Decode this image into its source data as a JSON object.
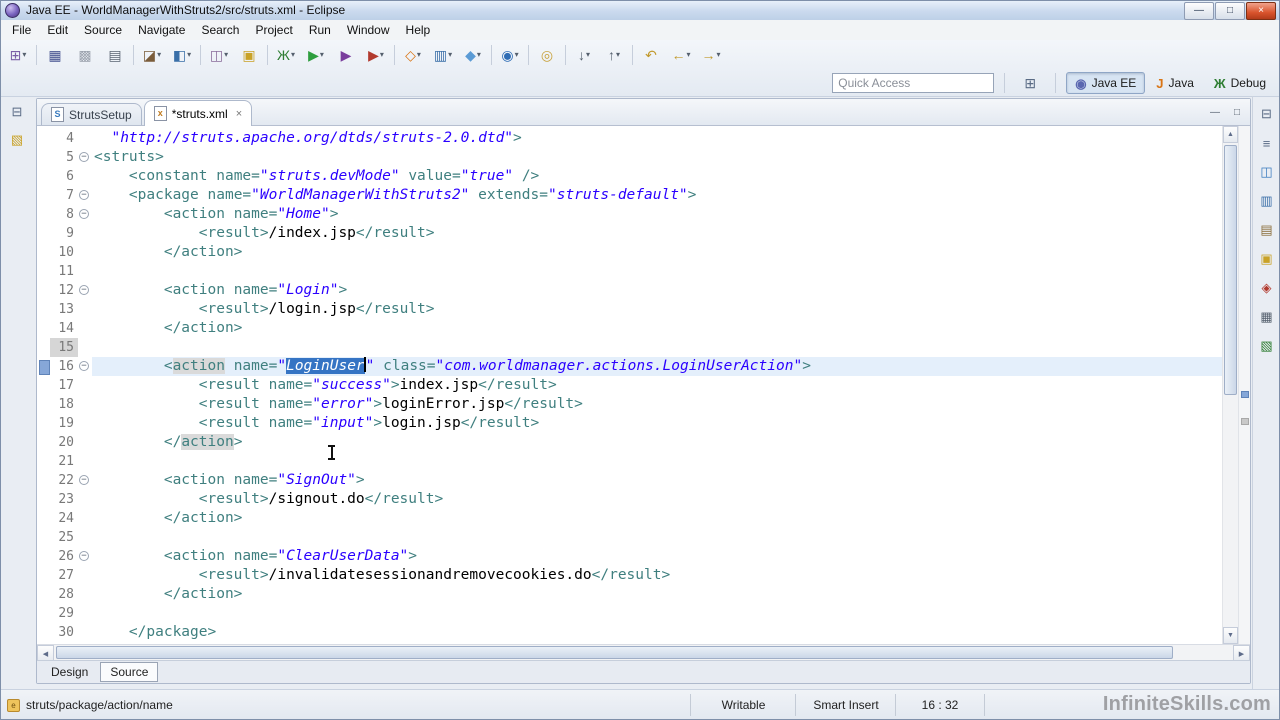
{
  "colors": {
    "xml_tag": "#3F7F7F",
    "xml_value": "#2A00FF",
    "selection_bg": "#3574C4",
    "selection_fg": "#FFFFFF",
    "current_line": "#E4EFFB",
    "occurrence": "#DADADA",
    "line_number": "#787878"
  },
  "window": {
    "title": "Java EE - WorldManagerWithStruts2/src/struts.xml - Eclipse",
    "buttons": [
      {
        "name": "minimize",
        "g": "—"
      },
      {
        "name": "maximize",
        "g": "□"
      },
      {
        "name": "close",
        "g": "×"
      }
    ]
  },
  "menus": [
    "File",
    "Edit",
    "Source",
    "Navigate",
    "Search",
    "Project",
    "Run",
    "Window",
    "Help"
  ],
  "toolbar": {
    "dropdown_glyph": "▾",
    "open_perspective_glyph": "⊞",
    "quick_access_placeholder": "Quick Access",
    "icons": [
      {
        "name": "new-wizard",
        "g": "⊞",
        "c": "#7B5EA7",
        "dd": true
      },
      {
        "sep": true
      },
      {
        "name": "save",
        "g": "▦",
        "c": "#44518F"
      },
      {
        "name": "save-all",
        "g": "▩",
        "c": "#9AA1AC"
      },
      {
        "name": "print",
        "g": "▤",
        "c": "#5A6472"
      },
      {
        "sep": true
      },
      {
        "name": "new-java-ee-project",
        "g": "◪",
        "c": "#7A5C3A",
        "dd": true
      },
      {
        "name": "create-element",
        "g": "◧",
        "c": "#3A6FA8",
        "dd": true
      },
      {
        "sep": true
      },
      {
        "name": "open-task",
        "g": "◫",
        "c": "#8A6D9B",
        "dd": true
      },
      {
        "name": "mark-occurrences",
        "g": "▣",
        "c": "#C9A227"
      },
      {
        "sep": true
      },
      {
        "name": "debug",
        "g": "Ж",
        "c": "#2E7D32",
        "dd": true
      },
      {
        "name": "run",
        "g": "▶",
        "c": "#2E9E3E",
        "dd": true
      },
      {
        "name": "coverage",
        "g": "▶",
        "c": "#7A3E9D"
      },
      {
        "name": "external-tools",
        "g": "▶",
        "c": "#B23A2E",
        "dd": true
      },
      {
        "sep": true
      },
      {
        "name": "java-element",
        "g": "◇",
        "c": "#D97414",
        "dd": true
      },
      {
        "name": "new-server",
        "g": "▥",
        "c": "#3A6FA8",
        "dd": true
      },
      {
        "name": "web-service",
        "g": "◆",
        "c": "#5B9BD5",
        "dd": true
      },
      {
        "sep": true
      },
      {
        "name": "web-browser",
        "g": "◉",
        "c": "#2F6DB5",
        "dd": true
      },
      {
        "sep": true
      },
      {
        "name": "search",
        "g": "◎",
        "c": "#C8A23C"
      },
      {
        "sep": true
      },
      {
        "name": "next-annotation",
        "g": "↓",
        "c": "#55606E",
        "dd": true
      },
      {
        "name": "previous-annotation",
        "g": "↑",
        "c": "#55606E",
        "dd": true
      },
      {
        "sep": true
      },
      {
        "name": "last-edit-location",
        "g": "↶",
        "c": "#C29A2E"
      },
      {
        "name": "back",
        "g": "←",
        "c": "#C29A2E",
        "dd": true
      },
      {
        "name": "forward",
        "g": "→",
        "c": "#C29A2E",
        "dd": true
      }
    ],
    "perspectives": [
      {
        "label": "Java EE",
        "glyph": "◉",
        "color": "#5B67B1",
        "active": true
      },
      {
        "label": "Java",
        "glyph": "J",
        "color": "#D97414",
        "active": false
      },
      {
        "label": "Debug",
        "glyph": "Ж",
        "color": "#2E7D32",
        "active": false
      }
    ]
  },
  "left_dock": [
    {
      "name": "restore-project-explorer",
      "g": "⊟",
      "c": "#5A6B85"
    },
    {
      "name": "project-explorer",
      "g": "▧",
      "c": "#C9A227"
    }
  ],
  "right_dock": [
    {
      "name": "restore-right-views",
      "g": "⊟",
      "c": "#5A6B85"
    },
    {
      "name": "outline-view",
      "g": "≡",
      "c": "#5A6B85"
    },
    {
      "name": "task-list-view",
      "g": "◫",
      "c": "#3A7BBF"
    },
    {
      "name": "servers-view",
      "g": "▥",
      "c": "#3A6FA8"
    },
    {
      "name": "data-source-view",
      "g": "▤",
      "c": "#8A6D3B"
    },
    {
      "name": "snippets-view",
      "g": "▣",
      "c": "#C9A227"
    },
    {
      "name": "markers-view",
      "g": "◈",
      "c": "#B23A2E"
    },
    {
      "name": "properties-view",
      "g": "▦",
      "c": "#55606E"
    },
    {
      "name": "console-view",
      "g": "▧",
      "c": "#2E7D32"
    }
  ],
  "editor": {
    "close_glyph": "×",
    "fold_glyph": "−",
    "stack_buttons": [
      {
        "name": "minimize-editor",
        "g": "—"
      },
      {
        "name": "maximize-editor",
        "g": "□"
      }
    ],
    "tabs": [
      {
        "label": "StrutsSetup",
        "icon": "S",
        "icon_color": "#3A7BBF",
        "active": false
      },
      {
        "label": "*struts.xml",
        "icon": "x",
        "icon_color": "#C07A1E",
        "active": true,
        "closable": true
      }
    ],
    "bottom_tabs": [
      {
        "label": "Design",
        "active": false
      },
      {
        "label": "Source",
        "active": true
      }
    ]
  },
  "code": {
    "lines": [
      {
        "n": 4,
        "tokens": [
          [
            "p",
            "  "
          ],
          [
            "v",
            "\"http://struts.apache.org/dtds/struts-2.0.dtd\""
          ],
          [
            "t",
            ">"
          ]
        ]
      },
      {
        "n": 5,
        "fold": true,
        "tokens": [
          [
            "t",
            "<struts>"
          ]
        ]
      },
      {
        "n": 6,
        "tokens": [
          [
            "p",
            "    "
          ],
          [
            "t",
            "<constant"
          ],
          [
            "p",
            " "
          ],
          [
            "a",
            "name="
          ],
          [
            "v",
            "\"struts.devMode\""
          ],
          [
            "p",
            " "
          ],
          [
            "a",
            "value="
          ],
          [
            "v",
            "\"true\""
          ],
          [
            "p",
            " "
          ],
          [
            "t",
            "/>"
          ]
        ]
      },
      {
        "n": 7,
        "fold": true,
        "tokens": [
          [
            "p",
            "    "
          ],
          [
            "t",
            "<package"
          ],
          [
            "p",
            " "
          ],
          [
            "a",
            "name="
          ],
          [
            "v",
            "\"WorldManagerWithStruts2\""
          ],
          [
            "p",
            " "
          ],
          [
            "a",
            "extends="
          ],
          [
            "v",
            "\"struts-default\""
          ],
          [
            "t",
            ">"
          ]
        ]
      },
      {
        "n": 8,
        "fold": true,
        "tokens": [
          [
            "p",
            "        "
          ],
          [
            "t",
            "<action"
          ],
          [
            "p",
            " "
          ],
          [
            "a",
            "name="
          ],
          [
            "v",
            "\"Home\""
          ],
          [
            "t",
            ">"
          ]
        ]
      },
      {
        "n": 9,
        "tokens": [
          [
            "p",
            "            "
          ],
          [
            "t",
            "<result>"
          ],
          [
            "p",
            "/index.jsp"
          ],
          [
            "t",
            "</result>"
          ]
        ]
      },
      {
        "n": 10,
        "tokens": [
          [
            "p",
            "        "
          ],
          [
            "t",
            "</action>"
          ]
        ]
      },
      {
        "n": 11,
        "tokens": []
      },
      {
        "n": 12,
        "fold": true,
        "tokens": [
          [
            "p",
            "        "
          ],
          [
            "t",
            "<action"
          ],
          [
            "p",
            " "
          ],
          [
            "a",
            "name="
          ],
          [
            "v",
            "\"Login\""
          ],
          [
            "t",
            ">"
          ]
        ]
      },
      {
        "n": 13,
        "tokens": [
          [
            "p",
            "            "
          ],
          [
            "t",
            "<result>"
          ],
          [
            "p",
            "/login.jsp"
          ],
          [
            "t",
            "</result>"
          ]
        ]
      },
      {
        "n": 14,
        "tokens": [
          [
            "p",
            "        "
          ],
          [
            "t",
            "</action>"
          ]
        ]
      },
      {
        "n": 15,
        "numhl": true,
        "tokens": []
      },
      {
        "n": 16,
        "fold": true,
        "hl": true,
        "mark": true,
        "caret": true,
        "tokens": [
          [
            "p",
            "        "
          ],
          [
            "t",
            "<"
          ],
          [
            "to",
            "action"
          ],
          [
            "p",
            " "
          ],
          [
            "a",
            "name="
          ],
          [
            "v",
            "\""
          ],
          [
            "vs",
            "LoginUser"
          ],
          [
            "v",
            "\""
          ],
          [
            "p",
            " "
          ],
          [
            "a",
            "class="
          ],
          [
            "v",
            "\"com.worldmanager.actions.LoginUserAction\""
          ],
          [
            "t",
            ">"
          ]
        ]
      },
      {
        "n": 17,
        "tokens": [
          [
            "p",
            "            "
          ],
          [
            "t",
            "<result"
          ],
          [
            "p",
            " "
          ],
          [
            "a",
            "name="
          ],
          [
            "v",
            "\"success\""
          ],
          [
            "t",
            ">"
          ],
          [
            "p",
            "index.jsp"
          ],
          [
            "t",
            "</result>"
          ]
        ]
      },
      {
        "n": 18,
        "tokens": [
          [
            "p",
            "            "
          ],
          [
            "t",
            "<result"
          ],
          [
            "p",
            " "
          ],
          [
            "a",
            "name="
          ],
          [
            "v",
            "\"error\""
          ],
          [
            "t",
            ">"
          ],
          [
            "p",
            "loginError.jsp"
          ],
          [
            "t",
            "</result>"
          ]
        ]
      },
      {
        "n": 19,
        "tokens": [
          [
            "p",
            "            "
          ],
          [
            "t",
            "<result"
          ],
          [
            "p",
            " "
          ],
          [
            "a",
            "name="
          ],
          [
            "v",
            "\"input\""
          ],
          [
            "t",
            ">"
          ],
          [
            "p",
            "login.jsp"
          ],
          [
            "t",
            "</result>"
          ]
        ]
      },
      {
        "n": 20,
        "tokens": [
          [
            "p",
            "        "
          ],
          [
            "t",
            "</"
          ],
          [
            "to",
            "action"
          ],
          [
            "t",
            ">"
          ]
        ]
      },
      {
        "n": 21,
        "tokens": []
      },
      {
        "n": 22,
        "fold": true,
        "tokens": [
          [
            "p",
            "        "
          ],
          [
            "t",
            "<action"
          ],
          [
            "p",
            " "
          ],
          [
            "a",
            "name="
          ],
          [
            "v",
            "\"SignOut\""
          ],
          [
            "t",
            ">"
          ]
        ]
      },
      {
        "n": 23,
        "tokens": [
          [
            "p",
            "            "
          ],
          [
            "t",
            "<result>"
          ],
          [
            "p",
            "/signout.do"
          ],
          [
            "t",
            "</result>"
          ]
        ]
      },
      {
        "n": 24,
        "tokens": [
          [
            "p",
            "        "
          ],
          [
            "t",
            "</action>"
          ]
        ]
      },
      {
        "n": 25,
        "tokens": []
      },
      {
        "n": 26,
        "fold": true,
        "tokens": [
          [
            "p",
            "        "
          ],
          [
            "t",
            "<action"
          ],
          [
            "p",
            " "
          ],
          [
            "a",
            "name="
          ],
          [
            "v",
            "\"ClearUserData\""
          ],
          [
            "t",
            ">"
          ]
        ]
      },
      {
        "n": 27,
        "tokens": [
          [
            "p",
            "            "
          ],
          [
            "t",
            "<result>"
          ],
          [
            "p",
            "/invalidatesessionandremovecookies.do"
          ],
          [
            "t",
            "</result>"
          ]
        ]
      },
      {
        "n": 28,
        "tokens": [
          [
            "p",
            "        "
          ],
          [
            "t",
            "</action>"
          ]
        ]
      },
      {
        "n": 29,
        "tokens": []
      },
      {
        "n": 30,
        "tokens": [
          [
            "p",
            "    "
          ],
          [
            "t",
            "</package>"
          ]
        ]
      }
    ]
  },
  "status_bar": {
    "breadcrumb": "struts/package/action/name",
    "writable": "Writable",
    "insert_mode": "Smart Insert",
    "position": "16 : 32",
    "watermark": "InfiniteSkills.com"
  }
}
